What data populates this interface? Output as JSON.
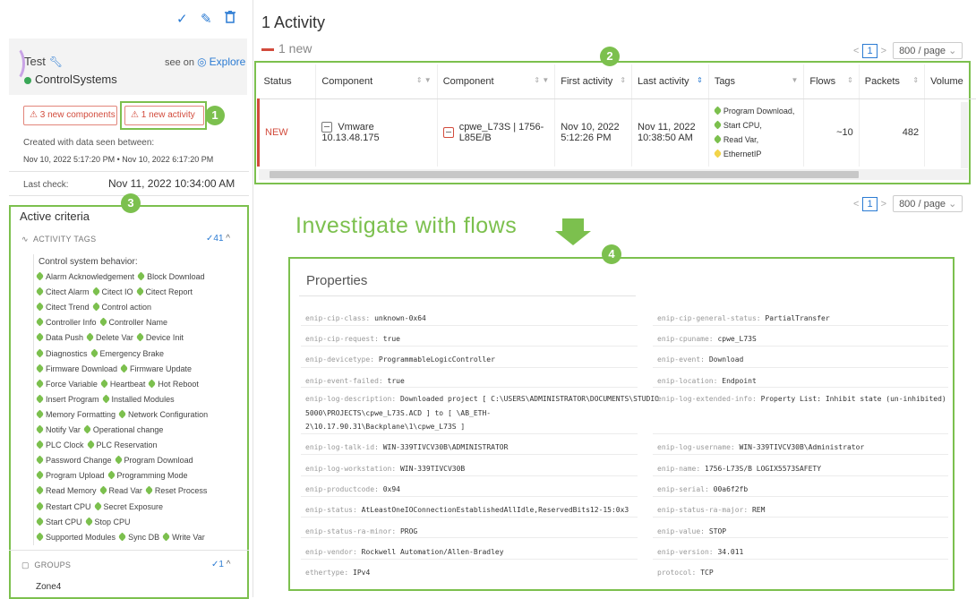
{
  "left": {
    "toolbar": {
      "check_icon": "✓",
      "edit_icon": "✎",
      "delete_icon": "🗑"
    },
    "name": "Test",
    "see_on": "see on",
    "explore": "Explore",
    "group": "ControlSystems",
    "btn_components": "3 new components",
    "btn_activity": "1 new activity",
    "created_label": "Created with data seen between:",
    "created_range": "Nov 10, 2022 5:17:20 PM • Nov 10, 2022 6:17:20 PM",
    "last_check_label": "Last check:",
    "last_check_value": "Nov 11, 2022 10:34:00 AM",
    "criteria_title": "Active criteria",
    "activity_tags_label": "ACTIVITY TAGS",
    "activity_tags_count": "✓41",
    "behavior_label": "Control system behavior:",
    "tags": [
      [
        "Alarm Acknowledgement",
        "Block Download"
      ],
      [
        "Citect Alarm",
        "Citect IO",
        "Citect Report"
      ],
      [
        "Citect Trend",
        "Control action"
      ],
      [
        "Controller Info",
        "Controller Name"
      ],
      [
        "Data Push",
        "Delete Var",
        "Device Init"
      ],
      [
        "Diagnostics",
        "Emergency Brake"
      ],
      [
        "Firmware Download",
        "Firmware Update"
      ],
      [
        "Force Variable",
        "Heartbeat",
        "Hot Reboot"
      ],
      [
        "Insert Program",
        "Installed Modules"
      ],
      [
        "Memory Formatting",
        "Network Configuration"
      ],
      [
        "Notify Var",
        "Operational change"
      ],
      [
        "PLC Clock",
        "PLC Reservation"
      ],
      [
        "Password Change",
        "Program Download"
      ],
      [
        "Program Upload",
        "Programming Mode"
      ],
      [
        "Read Memory",
        "Read Var",
        "Reset Process"
      ],
      [
        "Restart CPU",
        "Secret Exposure"
      ],
      [
        "Start CPU",
        "Stop CPU"
      ],
      [
        "Supported Modules",
        "Sync DB",
        "Write Var"
      ]
    ],
    "groups_label": "GROUPS",
    "groups_count": "✓1",
    "group_item": "Zone4"
  },
  "main": {
    "title": "1 Activity",
    "new_count": "1 new",
    "page": "1",
    "per_page": "800 / page",
    "columns": [
      "Status",
      "Component",
      "Component",
      "First activity",
      "Last activity",
      "Tags",
      "Flows",
      "Packets",
      "Volume"
    ],
    "row": {
      "status": "NEW",
      "component1": "Vmware 10.13.48.175",
      "component2_l1": "cpwe_L73S | 1756-",
      "component2_l2": "L85E/B",
      "first_l1": "Nov 10, 2022",
      "first_l2": "5:12:26 PM",
      "last_l1": "Nov 11, 2022",
      "last_l2": "10:38:50 AM",
      "tags": [
        "Program Download,",
        "Start CPU,",
        "Read Var,",
        "EthernetIP"
      ],
      "flows": "~10",
      "packets": "482"
    },
    "investigate": "Investigate with flows",
    "properties_title": "Properties",
    "properties_left": [
      {
        "k": "enip-cip-class:",
        "v": "unknown-0x64"
      },
      {
        "k": "enip-cip-request:",
        "v": "true"
      },
      {
        "k": "enip-devicetype:",
        "v": "ProgrammableLogicController"
      },
      {
        "k": "enip-event-failed:",
        "v": "true"
      },
      {
        "k": "enip-log-description:",
        "v": "Downloaded project [ C:\\USERS\\ADMINISTRATOR\\DOCUMENTS\\STUDIO"
      },
      {
        "k": "",
        "v": "5000\\PROJECTS\\cpwe_L73S.ACD ] to [ \\AB_ETH-"
      },
      {
        "k": "",
        "v": "2\\10.17.90.31\\Backplane\\1\\cpwe_L73S ]"
      },
      {
        "k": "enip-log-talk-id:",
        "v": "WIN-339TIVCV30B\\ADMINISTRATOR"
      },
      {
        "k": "enip-log-workstation:",
        "v": "WIN-339TIVCV30B"
      },
      {
        "k": "enip-productcode:",
        "v": "0x94"
      },
      {
        "k": "enip-status:",
        "v": "AtLeastOneIOConnectionEstablishedAllIdle,ReservedBits12-15:0x3"
      },
      {
        "k": "enip-status-ra-minor:",
        "v": "PROG"
      },
      {
        "k": "enip-vendor:",
        "v": "Rockwell Automation/Allen-Bradley"
      },
      {
        "k": "ethertype:",
        "v": "IPv4"
      }
    ],
    "properties_right": [
      {
        "k": "enip-cip-general-status:",
        "v": "PartialTransfer"
      },
      {
        "k": "enip-cpuname:",
        "v": "cpwe_L73S"
      },
      {
        "k": "enip-event:",
        "v": "Download"
      },
      {
        "k": "enip-location:",
        "v": "Endpoint"
      },
      {
        "k": "enip-log-extended-info:",
        "v": "Property List: Inhibit state (un-inhibited)"
      },
      {
        "k": "enip-log-username:",
        "v": "WIN-339TIVCV30B\\Administrator"
      },
      {
        "k": "enip-name:",
        "v": "1756-L73S/B LOGIX5573SAFETY"
      },
      {
        "k": "enip-serial:",
        "v": "00a6f2fb"
      },
      {
        "k": "enip-status-ra-major:",
        "v": "REM"
      },
      {
        "k": "enip-value:",
        "v": "STOP"
      },
      {
        "k": "enip-version:",
        "v": "34.011"
      },
      {
        "k": "protocol:",
        "v": "TCP"
      }
    ]
  },
  "badges": [
    "1",
    "2",
    "3",
    "4"
  ],
  "colors": {
    "accent": "#2b7bd3",
    "highlight": "#7cc04e",
    "alert": "#d24b3c"
  }
}
